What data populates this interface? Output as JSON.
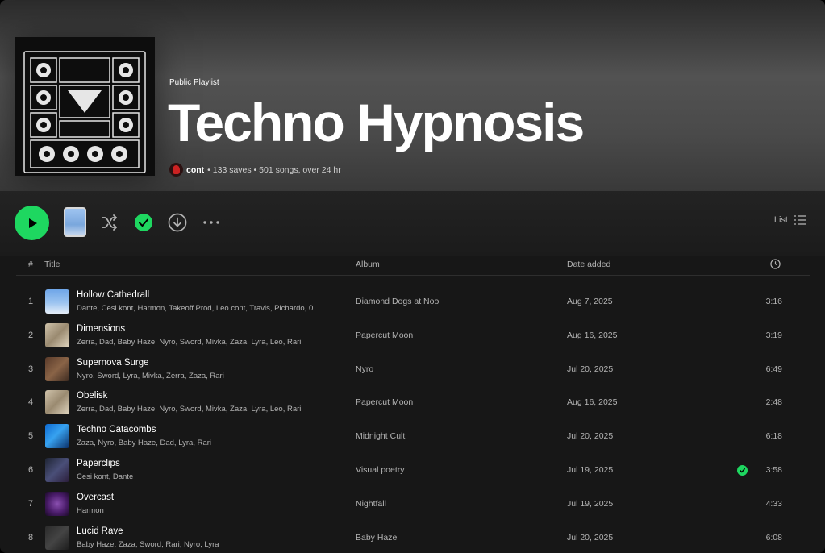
{
  "playlist": {
    "kind": "Public Playlist",
    "title": "Techno Hypnosis",
    "owner": "cont",
    "stats": "• 133 saves • 501 songs, over 24 hr"
  },
  "actions": {
    "list_label": "List"
  },
  "table": {
    "headers": {
      "index": "#",
      "title": "Title",
      "album": "Album",
      "date": "Date added"
    },
    "rows": [
      {
        "index": "1",
        "title": "Hollow Cathedrall",
        "artists": "Dante, Cesi kont, Harmon, Takeoff Prod, Leo cont, Travis, Pichardo, 0 ...",
        "album": "Diamond Dogs at Noo",
        "date": "Aug 7, 2025",
        "duration": "3:16",
        "saved": false,
        "art": "sky"
      },
      {
        "index": "2",
        "title": "Dimensions",
        "artists": "Zerra, Dad, Baby Haze, Nyro, Sword, Mivka, Zaza, Lyra, Leo, Rari",
        "album": "Papercut Moon",
        "date": "Aug 16, 2025",
        "duration": "3:19",
        "saved": false,
        "art": "paper"
      },
      {
        "index": "3",
        "title": "Supernova Surge",
        "artists": "Nyro, Sword, Lyra, Mivka, Zerra, Zaza, Rari",
        "album": "Nyro",
        "date": "Jul 20, 2025",
        "duration": "6:49",
        "saved": false,
        "art": "brown"
      },
      {
        "index": "4",
        "title": "Obelisk",
        "artists": "Zerra, Dad, Baby Haze, Nyro, Sword, Mivka, Zaza, Lyra, Leo, Rari",
        "album": "Papercut Moon",
        "date": "Aug 16, 2025",
        "duration": "2:48",
        "saved": false,
        "art": "paper"
      },
      {
        "index": "5",
        "title": "Techno Catacombs",
        "artists": "Zaza, Nyro, Baby Haze, Dad, Lyra, Rari",
        "album": "Midnight Cult",
        "date": "Jul 20, 2025",
        "duration": "6:18",
        "saved": false,
        "art": "blue"
      },
      {
        "index": "6",
        "title": "Paperclips",
        "artists": "Cesi kont, Dante",
        "album": "Visual poetry",
        "date": "Jul 19, 2025",
        "duration": "3:58",
        "saved": true,
        "art": "night"
      },
      {
        "index": "7",
        "title": "Overcast",
        "artists": "Harmon",
        "album": "Nightfall",
        "date": "Jul 19, 2025",
        "duration": "4:33",
        "saved": false,
        "art": "purple"
      },
      {
        "index": "8",
        "title": "Lucid Rave",
        "artists": "Baby Haze, Zaza, Sword, Rari, Nyro, Lyra",
        "album": "Baby Haze",
        "date": "Jul 20, 2025",
        "duration": "6:08",
        "saved": false,
        "art": "dark"
      }
    ]
  },
  "colors": {
    "accent": "#1ed760",
    "background": "#171717",
    "text_secondary": "#b3b3b3"
  },
  "icons": [
    "play-icon",
    "shuffle-icon",
    "check-icon",
    "download-icon",
    "more-icon",
    "list-icon",
    "clock-icon"
  ]
}
